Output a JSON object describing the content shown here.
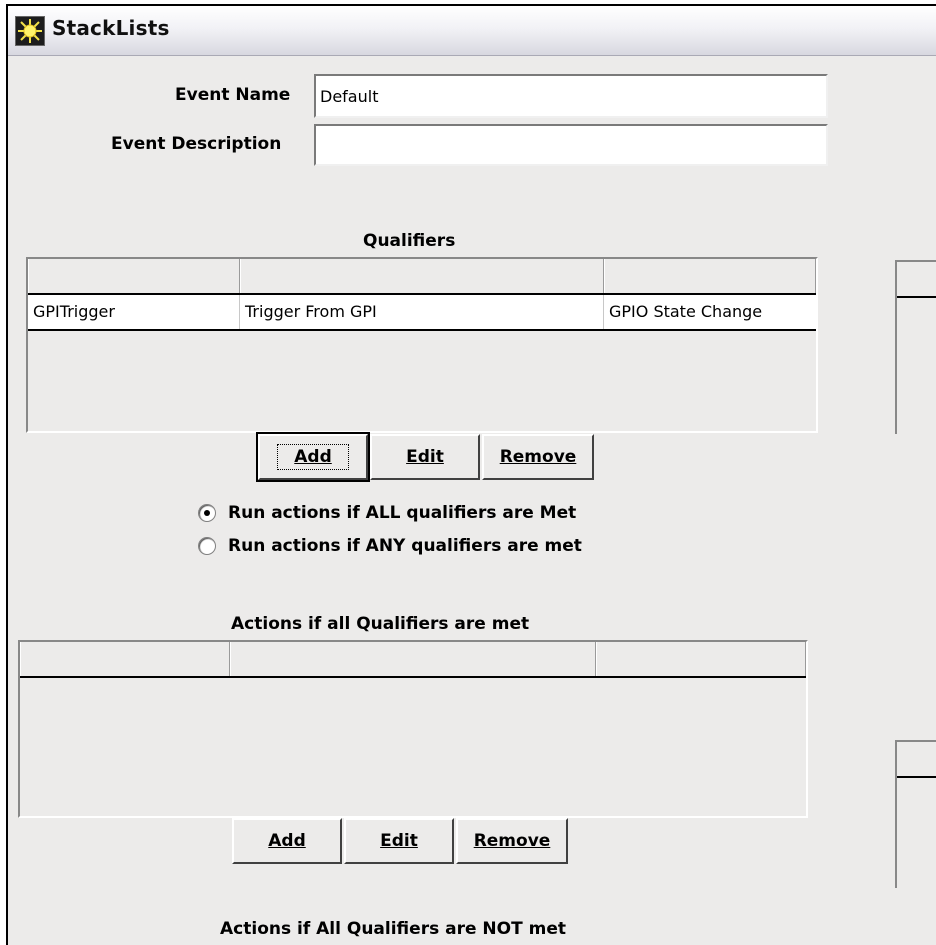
{
  "window": {
    "title": "StackLists",
    "icon": "sun-app-icon"
  },
  "form": {
    "event_name_label": "Event Name",
    "event_name_value": "Default",
    "event_description_label": "Event Description",
    "event_description_value": ""
  },
  "qualifiers": {
    "title": "Qualifiers",
    "columns": [
      "",
      "",
      ""
    ],
    "rows": [
      {
        "name": "GPITrigger",
        "description": "Trigger From GPI",
        "type": "GPIO State Change"
      }
    ],
    "buttons": {
      "add": "Add",
      "edit": "Edit",
      "remove": "Remove"
    }
  },
  "run_options": {
    "all_label": "Run actions if ALL qualifiers are Met",
    "any_label": "Run actions if ANY qualifiers are met",
    "selected": "all"
  },
  "actions_met": {
    "title": "Actions if all Qualifiers are met",
    "columns": [
      "",
      "",
      ""
    ],
    "rows": [],
    "buttons": {
      "add": "Add",
      "edit": "Edit",
      "remove": "Remove"
    }
  },
  "actions_not_met": {
    "title": "Actions if All Qualifiers are NOT met"
  }
}
